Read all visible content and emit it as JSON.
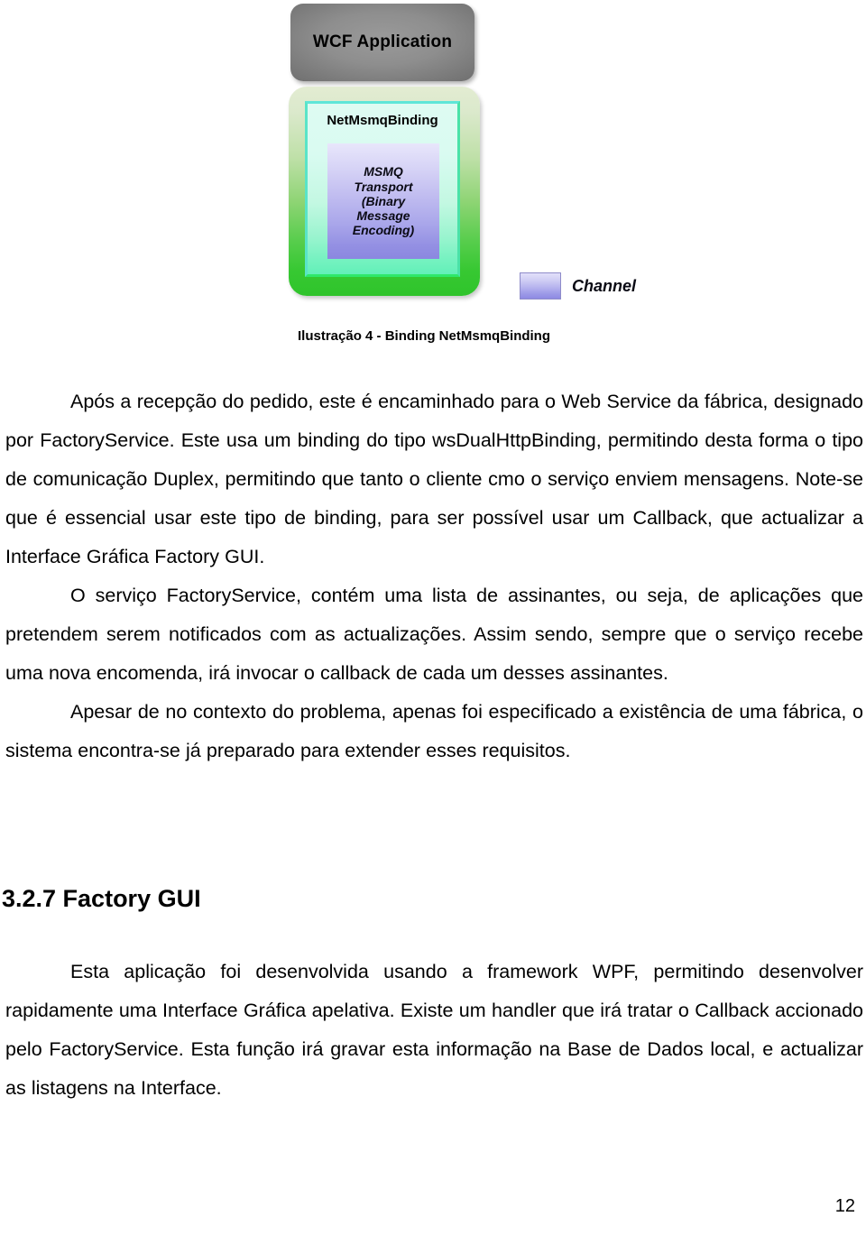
{
  "figure": {
    "wcf_application_label": "WCF Application",
    "binding_label": "NetMsmqBinding",
    "msmq_lines": [
      "MSMQ",
      "Transport",
      "(Binary",
      "Message",
      "Encoding)"
    ],
    "legend_label": "Channel",
    "caption": "Ilustração 4 - Binding NetMsmqBinding",
    "colors": {
      "wcf_box_gray": "#8e8e8e",
      "binding_outer_green": "#2fc42b",
      "binding_inner_mint": "#c3f8e2",
      "msmq_purple": "#a9a6ea",
      "channel_swatch": "#b4b1ee"
    }
  },
  "body": {
    "paragraph_1": "Após a recepção do pedido, este é encaminhado para o Web Service da fábrica, designado por FactoryService. Este usa um binding do tipo wsDualHttpBinding, permitindo desta forma o tipo de comunicação Duplex, permitindo que tanto o cliente cmo o serviço enviem mensagens. Note-se que é essencial usar este tipo de binding, para ser possível usar um Callback, que actualizar a Interface Gráfica Factory GUI.",
    "paragraph_2": "O serviço FactoryService, contém uma lista de assinantes, ou seja, de aplicações que pretendem serem notificados com as actualizações. Assim sendo, sempre que o serviço recebe uma nova encomenda, irá invocar o callback de cada um desses assinantes.",
    "paragraph_3": "Apesar de no contexto do problema, apenas foi especificado a existência de uma fábrica, o sistema encontra-se já preparado para extender esses requisitos.",
    "section_heading": "3.2.7 Factory GUI",
    "paragraph_4": "Esta aplicação foi desenvolvida usando a framework WPF, permitindo desenvolver rapidamente uma Interface Gráfica apelativa. Existe um handler que irá tratar o Callback accionado pelo FactoryService. Esta função irá gravar esta informação na Base de Dados local, e actualizar as listagens na Interface."
  },
  "footer": {
    "page_number": "12"
  }
}
